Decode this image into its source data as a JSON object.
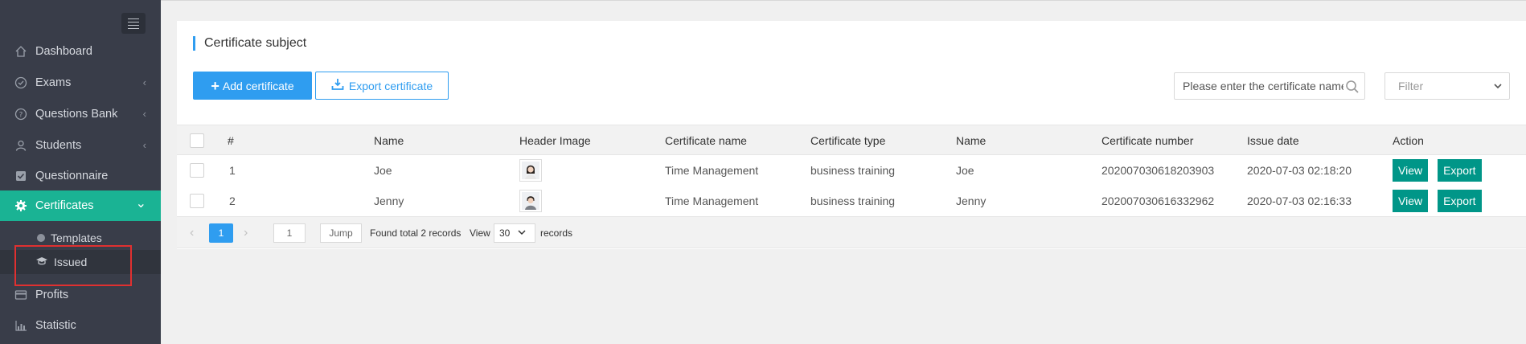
{
  "sidebar": {
    "items": [
      {
        "label": "Dashboard",
        "icon": "home-icon"
      },
      {
        "label": "Exams",
        "icon": "check-circle-icon",
        "chevron": "‹"
      },
      {
        "label": "Questions Bank",
        "icon": "question-circle-icon",
        "chevron": "‹"
      },
      {
        "label": "Students",
        "icon": "user-icon",
        "chevron": "‹"
      },
      {
        "label": "Questionnaire",
        "icon": "checkbox-icon"
      },
      {
        "label": "Certificates",
        "icon": "gear-icon",
        "chevron": "⌄"
      },
      {
        "label": "Profits",
        "icon": "credit-card-icon"
      },
      {
        "label": "Statistic",
        "icon": "bar-chart-icon"
      }
    ],
    "sub_items": [
      {
        "label": "Templates",
        "icon": "dot-icon"
      },
      {
        "label": "Issued",
        "icon": "graduation-cap-icon"
      }
    ]
  },
  "panel": {
    "title": "Certificate subject",
    "add_label": "Add certificate",
    "export_label": "Export certificate",
    "search_placeholder": "Please enter the certificate name",
    "filter_placeholder": "Filter"
  },
  "table": {
    "headers": [
      "#",
      "Name",
      "Header Image",
      "Certificate name",
      "Certificate type",
      "Name",
      "Certificate number",
      "Issue date",
      "Action"
    ],
    "rows": [
      {
        "index": "1",
        "name": "Joe",
        "cert_name": "Time Management",
        "cert_type": "business training",
        "name2": "Joe",
        "number": "202007030618203903",
        "date": "2020-07-03 02:18:20"
      },
      {
        "index": "2",
        "name": "Jenny",
        "cert_name": "Time Management",
        "cert_type": "business training",
        "name2": "Jenny",
        "number": "202007030616332962",
        "date": "2020-07-03 02:16:33"
      }
    ],
    "view_label": "View",
    "export_label": "Export"
  },
  "pager": {
    "current_page": "1",
    "jump_value": "1",
    "jump_label": "Jump",
    "total_text": "Found total 2 records",
    "view_label": "View",
    "per_page": "30",
    "records_label": "records"
  },
  "colors": {
    "sidebar": "#393d49",
    "active": "#1ab394",
    "accent": "#2f9df0",
    "action": "#009688"
  }
}
